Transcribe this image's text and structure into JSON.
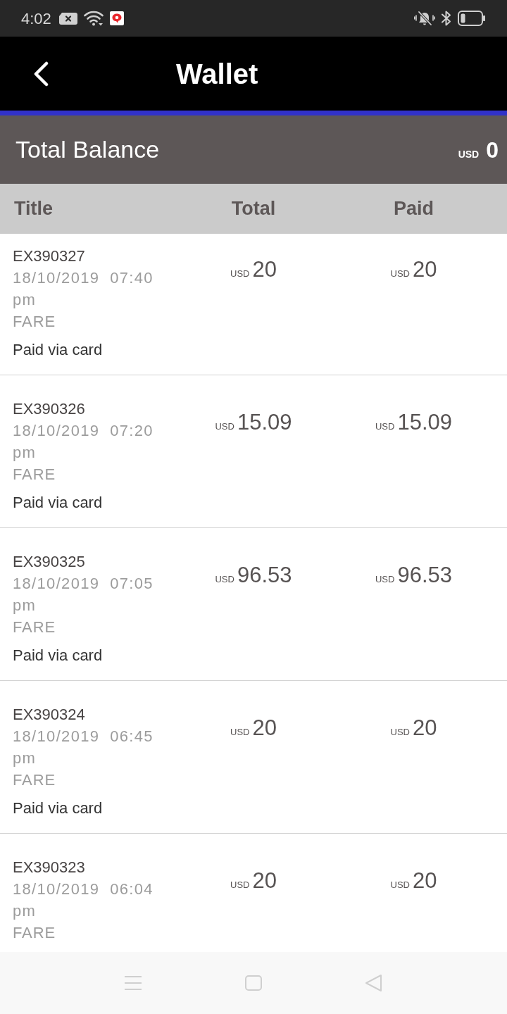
{
  "status_bar": {
    "time": "4:02"
  },
  "app_bar": {
    "title": "Wallet"
  },
  "balance": {
    "label": "Total Balance",
    "currency": "USD",
    "amount": "0"
  },
  "table": {
    "columns": [
      "Title",
      "Total",
      "Paid"
    ],
    "rows": [
      {
        "title": "EX390327",
        "datetime": "18/10/2019  07:40 pm",
        "category": "FARE",
        "payment": "Paid via card",
        "total": {
          "currency": "USD",
          "amount": "20"
        },
        "paid": {
          "currency": "USD",
          "amount": "20"
        }
      },
      {
        "title": "EX390326",
        "datetime": "18/10/2019  07:20 pm",
        "category": "FARE",
        "payment": "Paid via card",
        "total": {
          "currency": "USD",
          "amount": "15.09"
        },
        "paid": {
          "currency": "USD",
          "amount": "15.09"
        }
      },
      {
        "title": "EX390325",
        "datetime": "18/10/2019  07:05 pm",
        "category": "FARE",
        "payment": "Paid via card",
        "total": {
          "currency": "USD",
          "amount": "96.53"
        },
        "paid": {
          "currency": "USD",
          "amount": "96.53"
        }
      },
      {
        "title": "EX390324",
        "datetime": "18/10/2019  06:45 pm",
        "category": "FARE",
        "payment": "Paid via card",
        "total": {
          "currency": "USD",
          "amount": "20"
        },
        "paid": {
          "currency": "USD",
          "amount": "20"
        }
      },
      {
        "title": "EX390323",
        "datetime": "18/10/2019  06:04 pm",
        "category": "FARE",
        "total": {
          "currency": "USD",
          "amount": "20"
        },
        "paid": {
          "currency": "USD",
          "amount": "20"
        }
      }
    ]
  }
}
